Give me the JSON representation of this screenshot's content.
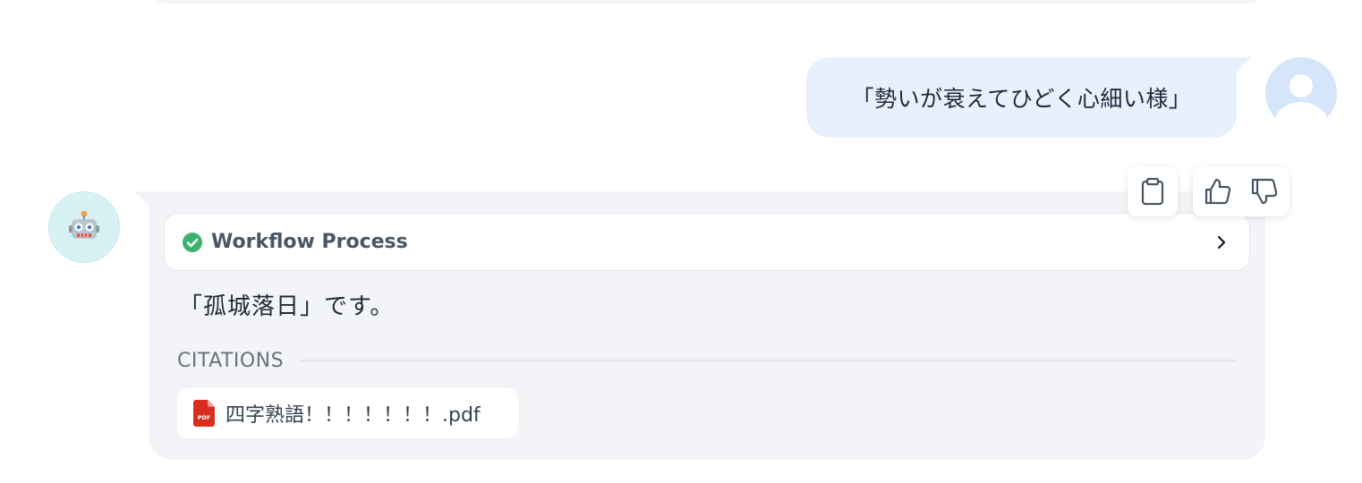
{
  "user_message": {
    "text": "「勢いが衰えてひどく心細い様」",
    "avatar_icon": "user-avatar-icon"
  },
  "bot_message": {
    "avatar_icon": "robot-icon",
    "workflow": {
      "label": "Workflow Process",
      "status_icon": "check-circle-icon",
      "status_color": "#3fb16f",
      "expand_icon": "chevron-right-icon"
    },
    "answer": "「孤城落日」です。",
    "citations": {
      "label": "CITATIONS",
      "items": [
        {
          "name": "四字熟語！！！！！！！.pdf",
          "icon": "pdf-file-icon",
          "icon_color": "#d92d20"
        }
      ]
    },
    "actions": {
      "copy_icon": "clipboard-icon",
      "like_icon": "thumbs-up-icon",
      "dislike_icon": "thumbs-down-icon"
    }
  }
}
